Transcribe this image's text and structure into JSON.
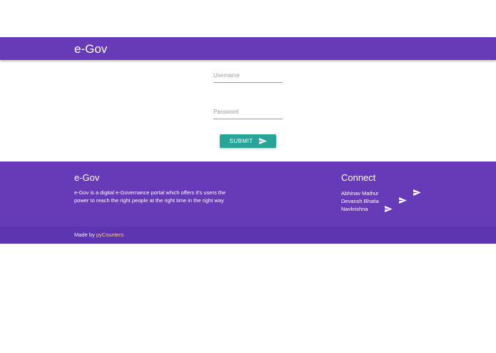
{
  "navbar": {
    "brand": "e-Gov",
    "color": "#673ab7"
  },
  "form": {
    "username_placeholder": "Username",
    "username_value": "",
    "password_placeholder": "Password",
    "password_value": "",
    "submit_label": "Submit",
    "submit_icon": "send-icon",
    "submit_color": "#26a69a"
  },
  "footer": {
    "title": "e-Gov",
    "description": "e-Gov is a digital e-Governance portal which offers it's users the power to reach the right people at the right time in the right way",
    "connect_title": "Connect",
    "connect_links": [
      {
        "label": "Abhinav Mathur",
        "icon": "send-icon"
      },
      {
        "label": "Devansh Bhatia",
        "icon": "send-icon"
      },
      {
        "label": "Navkrishna",
        "icon": "send-icon"
      }
    ],
    "made_by_prefix": "Made by",
    "made_by_link": "pyCounters",
    "copyright_color": "#5e35b1"
  }
}
